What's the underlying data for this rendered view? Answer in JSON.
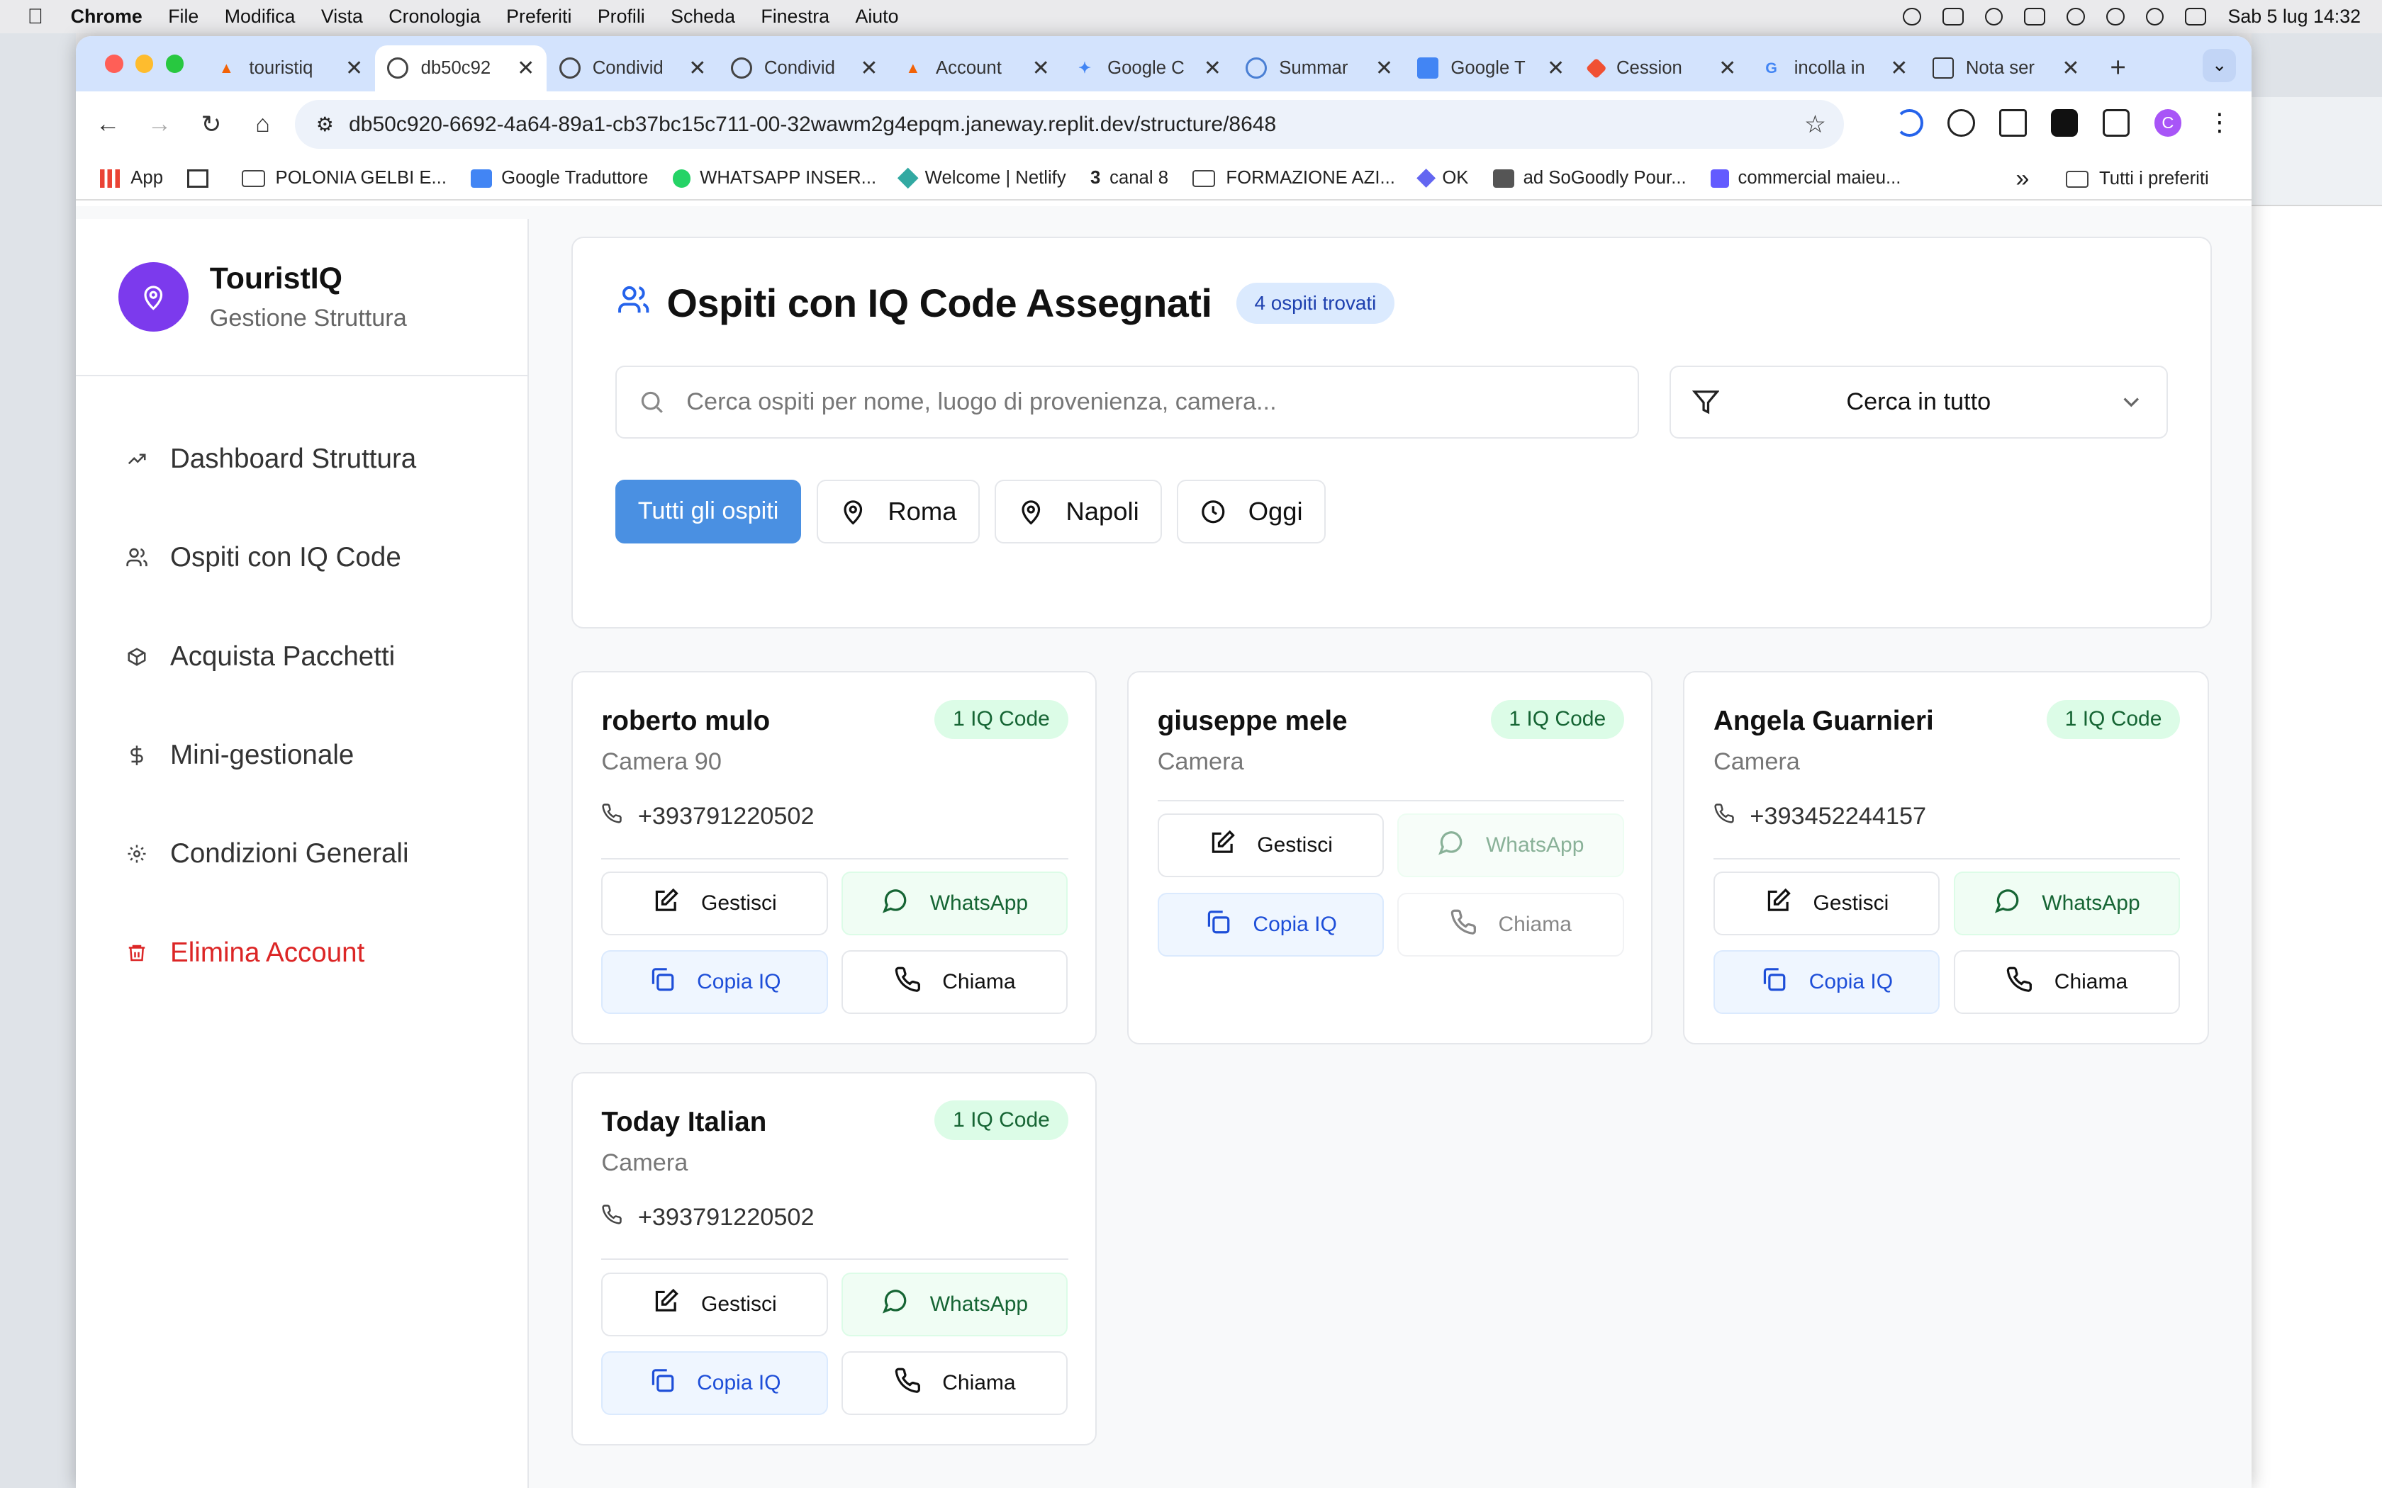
{
  "menubar": {
    "app": "Chrome",
    "items": [
      "File",
      "Modifica",
      "Vista",
      "Cronologia",
      "Preferiti",
      "Profili",
      "Scheda",
      "Finestra",
      "Aiuto"
    ],
    "datetime": "Sab 5 lug  14:32"
  },
  "tabs": [
    {
      "title": "touristiq",
      "icon": "replit-icon",
      "active": false
    },
    {
      "title": "db50c92",
      "icon": "globe-icon",
      "active": true
    },
    {
      "title": "Condivid",
      "icon": "globe-icon",
      "active": false
    },
    {
      "title": "Condivid",
      "icon": "globe-icon",
      "active": false
    },
    {
      "title": "Account",
      "icon": "replit-icon",
      "active": false
    },
    {
      "title": "Google C",
      "icon": "gemini-icon",
      "active": false
    },
    {
      "title": "Summar",
      "icon": "cloud-icon",
      "active": false
    },
    {
      "title": "Google T",
      "icon": "translate-icon",
      "active": false
    },
    {
      "title": "Cession",
      "icon": "git-icon",
      "active": false
    },
    {
      "title": "incolla in",
      "icon": "google-icon",
      "active": false
    },
    {
      "title": "Nota ser",
      "icon": "note-icon",
      "active": false
    }
  ],
  "address": {
    "url": "db50c920-6692-4a64-89a1-cb37bc15c711-00-32wawm2g4epqm.janeway.replit.dev/structure/8648"
  },
  "profile_letter": "C",
  "bookmarks": {
    "items": [
      "App",
      "POLONIA GELBI E...",
      "Google Traduttore",
      "WHATSAPP INSER...",
      "Welcome | Netlify",
      "canal 8",
      "FORMAZIONE AZI...",
      "OK",
      "ad SoGoodly Pour...",
      "commercial maieu..."
    ],
    "more": "»",
    "all": "Tutti i preferiti"
  },
  "sidebar": {
    "brand_title": "TouristIQ",
    "brand_subtitle": "Gestione Struttura",
    "items": [
      {
        "label": "Dashboard Struttura",
        "icon": "trending-up-icon"
      },
      {
        "label": "Ospiti con IQ Code",
        "icon": "users-icon"
      },
      {
        "label": "Acquista Pacchetti",
        "icon": "package-icon"
      },
      {
        "label": "Mini-gestionale",
        "icon": "dollar-icon"
      },
      {
        "label": "Condizioni Generali",
        "icon": "gear-icon"
      },
      {
        "label": "Elimina Account",
        "icon": "trash-icon"
      }
    ]
  },
  "panel": {
    "title": "Ospiti con IQ Code Assegnati",
    "count_badge": "4 ospiti trovati",
    "search_placeholder": "Cerca ospiti per nome, luogo di provenienza, camera...",
    "filter_value": "Cerca in tutto",
    "chips": [
      "Tutti gli ospiti",
      "Roma",
      "Napoli",
      "Oggi"
    ]
  },
  "guests": [
    {
      "name": "roberto mulo",
      "room": "Camera 90",
      "phone": "+393791220502",
      "iq": "1 IQ Code"
    },
    {
      "name": "giuseppe mele",
      "room": "Camera",
      "phone": "",
      "iq": "1 IQ Code"
    },
    {
      "name": "Angela Guarnieri",
      "room": "Camera",
      "phone": "+393452244157",
      "iq": "1 IQ Code"
    },
    {
      "name": "Today Italian",
      "room": "Camera",
      "phone": "+393791220502",
      "iq": "1 IQ Code"
    }
  ],
  "actions": {
    "manage": "Gestisci",
    "whatsapp": "WhatsApp",
    "copy": "Copia IQ",
    "call": "Chiama"
  },
  "colors": {
    "brand": "#7c3aed",
    "primary": "#4a90e2",
    "danger": "#dc2626",
    "success_bg": "#dcfce7",
    "tabstrip": "#d3e3fd"
  }
}
